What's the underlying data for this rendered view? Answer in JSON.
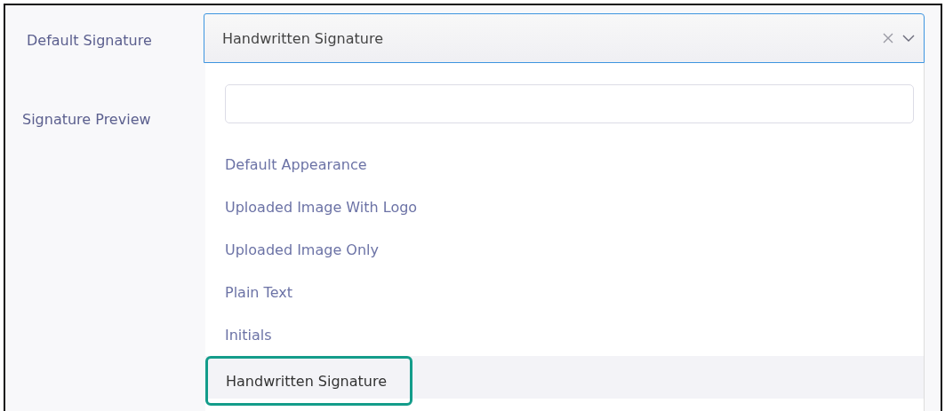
{
  "fields": [
    {
      "label": "Default Signature"
    },
    {
      "label": "Signature Preview"
    }
  ],
  "select": {
    "value": "Handwritten Signature",
    "open": true
  },
  "options": [
    {
      "label": "Default Appearance",
      "selected": false
    },
    {
      "label": "Uploaded Image With Logo",
      "selected": false
    },
    {
      "label": "Uploaded Image Only",
      "selected": false
    },
    {
      "label": "Plain Text",
      "selected": false
    },
    {
      "label": "Initials",
      "selected": false
    },
    {
      "label": "Handwritten Signature",
      "selected": true
    }
  ]
}
